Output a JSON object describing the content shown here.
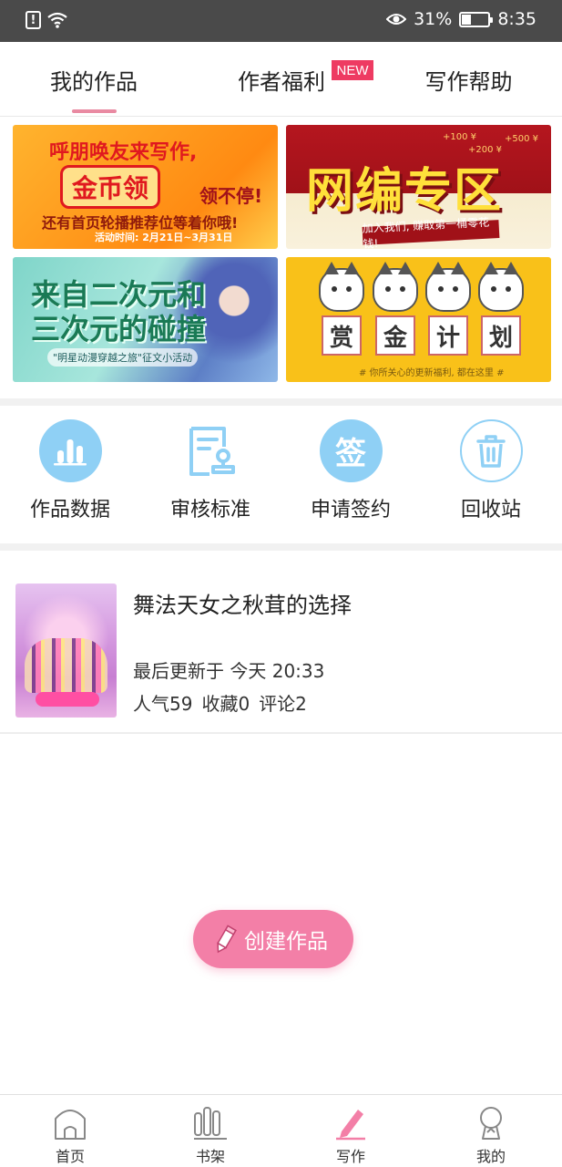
{
  "status_bar": {
    "battery": "31%",
    "battery_level": 0.31,
    "time": "8:35"
  },
  "tabs": [
    {
      "label": "我的作品",
      "active": true
    },
    {
      "label": "作者福利",
      "badge": "NEW"
    },
    {
      "label": "写作帮助"
    }
  ],
  "banners": [
    {
      "line1": "呼朋唤友来写作,",
      "big": "金币领",
      "big_tail": "领不停!",
      "line3": "还有首页轮播推荐位等着你哦!",
      "date": "活动时间: 2月21日~3月31日"
    },
    {
      "title": "网编专区",
      "sub": "加入我们, 赚取第一桶零花钱!",
      "money1": "+100 ¥",
      "money2": "+500 ¥",
      "money3": "+200 ¥"
    },
    {
      "title_line1": "来自二次元和",
      "title_line2": "三次元的碰撞",
      "sub": "\"明星动漫穿越之旅\"征文小活动"
    },
    {
      "chars": [
        "赏",
        "金",
        "计",
        "划"
      ],
      "note": "# 你所关心的更新福利, 都在这里 #"
    }
  ],
  "features": [
    {
      "label": "作品数据",
      "icon": "bar-chart-icon"
    },
    {
      "label": "审核标准",
      "icon": "document-stamp-icon"
    },
    {
      "label": "申请签约",
      "icon": "sign-icon",
      "icon_text": "签"
    },
    {
      "label": "回收站",
      "icon": "trash-icon"
    }
  ],
  "work": {
    "title": "舞法天女之秋茸的选择",
    "updated": "最后更新于 今天 20:33",
    "popularity": "人气59",
    "favorites": "收藏0",
    "comments": "评论2"
  },
  "create_button": {
    "label": "创建作品"
  },
  "bottom_nav": [
    {
      "label": "首页",
      "icon": "home-icon"
    },
    {
      "label": "书架",
      "icon": "bookshelf-icon"
    },
    {
      "label": "写作",
      "icon": "pencil-icon",
      "active": true
    },
    {
      "label": "我的",
      "icon": "user-icon"
    }
  ],
  "colors": {
    "accent": "#f37fa7",
    "indicator": "#e98aa2",
    "badge": "#ee3b62",
    "feature_icon_bg": "#8fd0f5",
    "status_bar": "#4a4a4a"
  }
}
